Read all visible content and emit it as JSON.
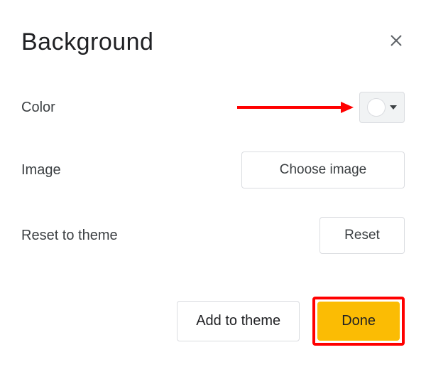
{
  "dialog": {
    "title": "Background"
  },
  "rows": {
    "color": {
      "label": "Color",
      "selected_color": "#ffffff"
    },
    "image": {
      "label": "Image",
      "button": "Choose image"
    },
    "reset": {
      "label": "Reset to theme",
      "button": "Reset"
    }
  },
  "footer": {
    "add_to_theme": "Add to theme",
    "done": "Done"
  },
  "annotation": {
    "arrow_color": "#ff0000",
    "highlight_color": "#ff0000"
  }
}
